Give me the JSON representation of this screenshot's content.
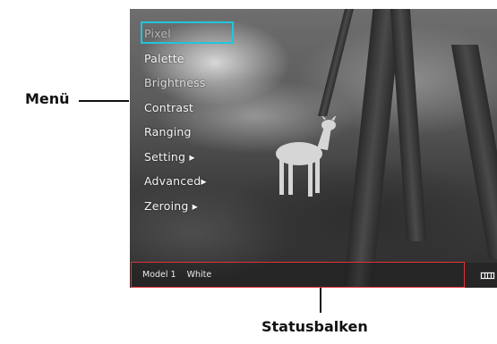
{
  "menu": {
    "items": [
      {
        "label": "Pixel"
      },
      {
        "label": "Palette"
      },
      {
        "label": "Brightness"
      },
      {
        "label": "Contrast"
      },
      {
        "label": "Ranging"
      },
      {
        "label": "Setting ▸"
      },
      {
        "label": "Advanced▸"
      },
      {
        "label": "Zeroing ▸"
      }
    ],
    "selected_index": 0
  },
  "status_bar": {
    "model": "Model 1",
    "palette": "White",
    "battery_icon": "battery-icon"
  },
  "annotations": {
    "menu_label": "Menü",
    "status_label": "Statusbalken"
  },
  "colors": {
    "selection_border": "#1fc6dc",
    "status_frame": "#e0333a"
  }
}
